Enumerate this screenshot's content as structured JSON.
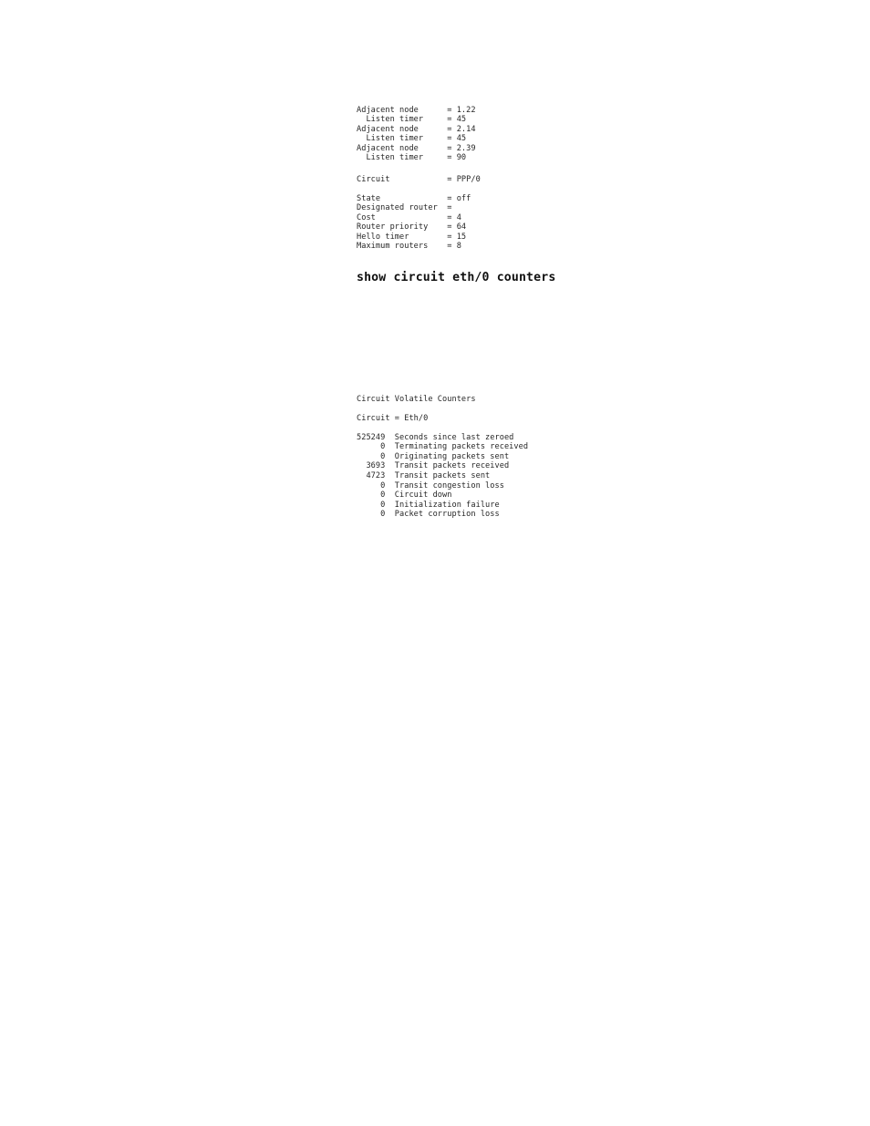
{
  "document": {
    "type": "cli-output",
    "background_color": "#ffffff",
    "text_color": "#262626"
  },
  "adjacency_block": {
    "name": "adjacent-node-listing",
    "lines": [
      "Adjacent node      = 1.22",
      "  Listen timer     = 45",
      "Adjacent node      = 2.14",
      "  Listen timer     = 45",
      "Adjacent node      = 2.39",
      "  Listen timer     = 90"
    ],
    "entries": [
      {
        "adjacent_node": "1.22",
        "listen_timer": "45"
      },
      {
        "adjacent_node": "2.14",
        "listen_timer": "45"
      },
      {
        "adjacent_node": "2.39",
        "listen_timer": "90"
      }
    ]
  },
  "circuit_block": {
    "name": "circuit-ppp0-parameters",
    "lines": [
      "Circuit            = PPP/0",
      "",
      "State              = off",
      "Designated router  =",
      "Cost               = 4",
      "Router priority    = 64",
      "Hello timer        = 15",
      "Maximum routers    = 8"
    ],
    "fields": [
      {
        "label": "Circuit",
        "value": "PPP/0"
      },
      {
        "label": "State",
        "value": "off"
      },
      {
        "label": "Designated router",
        "value": ""
      },
      {
        "label": "Cost",
        "value": "4"
      },
      {
        "label": "Router priority",
        "value": "64"
      },
      {
        "label": "Hello timer",
        "value": "15"
      },
      {
        "label": "Maximum routers",
        "value": "8"
      }
    ]
  },
  "command_heading": {
    "name": "show-circuit-counters-command",
    "text": "show circuit eth/0 counters"
  },
  "counters_block": {
    "name": "circuit-volatile-counters",
    "title": "Circuit Volatile Counters",
    "circuit_line": "Circuit = Eth/0",
    "circuit_name": "Eth/0",
    "lines": [
      "Circuit Volatile Counters",
      "",
      "Circuit = Eth/0",
      "",
      "525249  Seconds since last zeroed",
      "     0  Terminating packets received",
      "     0  Originating packets sent",
      "  3693  Transit packets received",
      "  4723  Transit packets sent",
      "     0  Transit congestion loss",
      "     0  Circuit down",
      "     0  Initialization failure",
      "     0  Packet corruption loss"
    ],
    "counters": [
      {
        "value": "525249",
        "label": "Seconds since last zeroed"
      },
      {
        "value": "0",
        "label": "Terminating packets received"
      },
      {
        "value": "0",
        "label": "Originating packets sent"
      },
      {
        "value": "3693",
        "label": "Transit packets received"
      },
      {
        "value": "4723",
        "label": "Transit packets sent"
      },
      {
        "value": "0",
        "label": "Transit congestion loss"
      },
      {
        "value": "0",
        "label": "Circuit down"
      },
      {
        "value": "0",
        "label": "Initialization failure"
      },
      {
        "value": "0",
        "label": "Packet corruption loss"
      }
    ]
  }
}
